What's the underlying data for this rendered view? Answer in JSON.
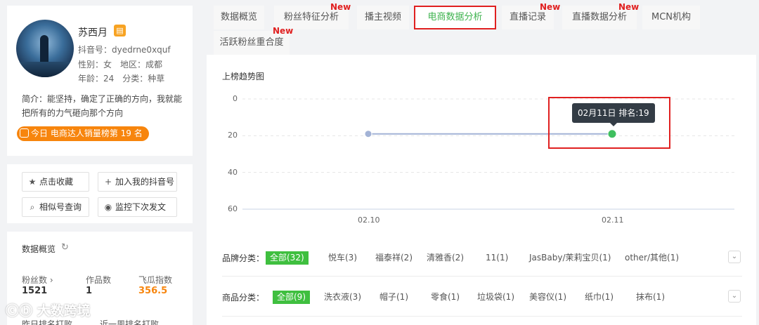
{
  "profile": {
    "name": "苏西月",
    "badge_icon": "shop-badge-icon",
    "douyin_id": "抖音号：dyedrne0xquf",
    "gender_region": "性别：女　地区：成都",
    "age_category": "年龄：24　分类：种草",
    "bio": "简介：能坚持，确定了正确的方向，我就能把所有的力气砸向那个方向",
    "rank_text": "今日 电商达人销量榜第 19 名"
  },
  "actions": {
    "favorite": "点击收藏",
    "add_mine": "加入我的抖音号",
    "similar": "相似号查询",
    "monitor": "监控下次发文"
  },
  "overview": {
    "title": "数据概览",
    "stats": [
      {
        "label": "粉丝数 ›",
        "value": "1521"
      },
      {
        "label": "作品数",
        "value": "1"
      },
      {
        "label": "飞瓜指数",
        "value": "356.5"
      }
    ],
    "more_left": "昨日排名打败",
    "more_right": "近一周排名打败"
  },
  "tabs": [
    {
      "label": "数据概览",
      "new": false
    },
    {
      "label": "粉丝特征分析",
      "new": true
    },
    {
      "label": "播主视频",
      "new": false
    },
    {
      "label": "电商数据分析",
      "new": false,
      "active": true
    },
    {
      "label": "直播记录",
      "new": true
    },
    {
      "label": "直播数据分析",
      "new": true
    },
    {
      "label": "MCN机构",
      "new": false
    },
    {
      "label": "活跃粉丝重合度",
      "new": true
    }
  ],
  "new_tag": "New",
  "chart_data": {
    "type": "line",
    "title": "上榜趋势图",
    "xlabel": "",
    "ylabel": "",
    "categories": [
      "02.10",
      "02.11"
    ],
    "y_reversed": true,
    "ylim": [
      0,
      60
    ],
    "y_ticks": [
      0,
      20,
      40,
      60
    ],
    "series": [
      {
        "values": [
          19,
          19
        ]
      }
    ],
    "point_colors": [
      "#a3b3d6",
      "#3fbf5f"
    ],
    "tooltip": "02月11日 排名:19",
    "grid": true
  },
  "filters": {
    "brand": {
      "label": "品牌分类：",
      "items": [
        "全部(32)",
        "悦车(3)",
        "福泰祥(2)",
        "清雅香(2)",
        "11(1)",
        "JasBaby/茉莉宝贝(1)",
        "other/其他(1)"
      ],
      "expand_icon": "chevron-down-icon"
    },
    "product": {
      "label": "商品分类：",
      "items": [
        "全部(9)",
        "洗衣液(3)",
        "帽子(1)",
        "零食(1)",
        "垃圾袋(1)",
        "美容仪(1)",
        "纸巾(1)",
        "抹布(1)"
      ],
      "expand_icon": "chevron-down-icon"
    }
  },
  "watermark": "大数跨境",
  "colors": {
    "accent_orange": "#f7850d",
    "active_green": "#3fb34f",
    "chip_green": "#3fbf3f",
    "highlight_red": "#e02020"
  }
}
